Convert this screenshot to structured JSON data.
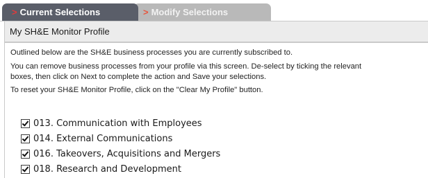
{
  "tabs": [
    {
      "arrow": ">",
      "label": "Current Selections"
    },
    {
      "arrow": ">",
      "label": "Modify Selections"
    }
  ],
  "panel": {
    "title": "My SH&E Monitor Profile",
    "lines": [
      "Outlined below are the SH&E business processes you are currently subscribed to.",
      "You can remove business processes from your profile via this screen. De-select by ticking the relevant",
      "boxes, then click on Next to complete the action and Save your selections.",
      "To reset your SH&E Monitor Profile, click on the \"Clear My Profile\" button."
    ]
  },
  "processes": [
    {
      "label": "013. Communication with Employees",
      "checked": true
    },
    {
      "label": "014. External Communications",
      "checked": true
    },
    {
      "label": "016. Takeovers, Acquisitions and Mergers",
      "checked": true
    },
    {
      "label": "018. Research and Development",
      "checked": true
    }
  ]
}
